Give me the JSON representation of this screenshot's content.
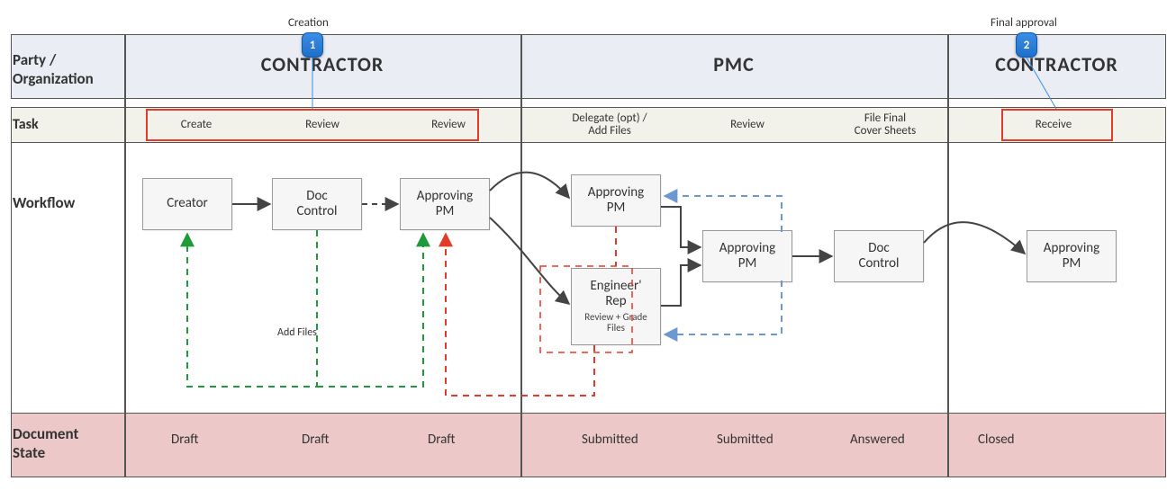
{
  "annotations": {
    "creation": "Creation",
    "final_approval": "Final approval"
  },
  "badges": {
    "one": "1",
    "two": "2"
  },
  "rows": {
    "party_label_line1": "Party /",
    "party_label_line2": "Organization",
    "task_label": "Task",
    "workflow_label": "Workflow",
    "docstate_label_line1": "Document",
    "docstate_label_line2": "State"
  },
  "parties": {
    "contractor1": "CONTRACTOR",
    "pmc": "PMC",
    "contractor2": "CONTRACTOR"
  },
  "tasks": {
    "create": "Create",
    "review1": "Review",
    "review2": "Review",
    "delegate_line1": "Delegate (opt) /",
    "delegate_line2": "Add Files",
    "review3": "Review",
    "filefinal_line1": "File Final",
    "filefinal_line2": "Cover Sheets",
    "receive": "Receive"
  },
  "workflow": {
    "creator": "Creator",
    "doc_control1": "Doc\nControl",
    "approving_pm1": "Approving\nPM",
    "approving_pm2": "Approving\nPM",
    "engineer_rep": "Engineer'\nRep",
    "engineer_rep_sub": "Review + Grade\nFiles",
    "approving_pm3": "Approving\nPM",
    "doc_control2": "Doc\nControl",
    "approving_pm4": "Approving\nPM",
    "add_files": "Add Files"
  },
  "docstates": {
    "draft1": "Draft",
    "draft2": "Draft",
    "draft3": "Draft",
    "submitted1": "Submitted",
    "submitted2": "Submitted",
    "answered": "Answered",
    "closed": "Closed"
  },
  "chart_data": {
    "type": "swimlane-workflow",
    "rows": [
      "Party / Organization",
      "Task",
      "Workflow",
      "Document State"
    ],
    "lanes": [
      {
        "party": "CONTRACTOR",
        "tasks": [
          "Create",
          "Review",
          "Review"
        ],
        "doc_states": [
          "Draft",
          "Draft",
          "Draft"
        ],
        "annotation": "Creation",
        "badge": 1,
        "highlight": "tasks"
      },
      {
        "party": "PMC",
        "tasks": [
          "Delegate (opt) / Add Files",
          "Review",
          "File Final Cover Sheets"
        ],
        "doc_states": [
          "Submitted",
          "Submitted",
          "Answered"
        ]
      },
      {
        "party": "CONTRACTOR",
        "tasks": [
          "Receive"
        ],
        "doc_states": [
          "Closed"
        ],
        "annotation": "Final approval",
        "badge": 2,
        "highlight": "tasks"
      }
    ],
    "nodes": [
      {
        "id": "creator",
        "label": "Creator",
        "lane": 0
      },
      {
        "id": "doccontrol1",
        "label": "Doc Control",
        "lane": 0
      },
      {
        "id": "apppm1",
        "label": "Approving PM",
        "lane": 0
      },
      {
        "id": "apppm2",
        "label": "Approving PM",
        "lane": 1
      },
      {
        "id": "engrep",
        "label": "Engineer' Rep",
        "sublabel": "Review + Grade Files",
        "lane": 1
      },
      {
        "id": "apppm3",
        "label": "Approving PM",
        "lane": 1
      },
      {
        "id": "doccontrol2",
        "label": "Doc Control",
        "lane": 1
      },
      {
        "id": "apppm4",
        "label": "Approving PM",
        "lane": 2
      }
    ],
    "edges": [
      {
        "from": "creator",
        "to": "doccontrol1",
        "style": "solid"
      },
      {
        "from": "doccontrol1",
        "to": "apppm1",
        "style": "dashed"
      },
      {
        "from": "apppm1",
        "to": "apppm2",
        "style": "solid-curve"
      },
      {
        "from": "apppm1",
        "to": "engrep",
        "style": "solid-curve"
      },
      {
        "from": "apppm2",
        "to": "apppm3",
        "style": "solid"
      },
      {
        "from": "engrep",
        "to": "apppm3",
        "style": "solid"
      },
      {
        "from": "apppm3",
        "to": "apppm2",
        "style": "dashed-blue",
        "meaning": "return"
      },
      {
        "from": "apppm3",
        "to": "engrep",
        "style": "dashed-blue",
        "meaning": "return"
      },
      {
        "from": "apppm3",
        "to": "doccontrol2",
        "style": "solid"
      },
      {
        "from": "doccontrol2",
        "to": "apppm4",
        "style": "solid-curve"
      },
      {
        "from": "doccontrol1",
        "to": "creator",
        "style": "dashed-green",
        "meaning": "Add Files loop"
      },
      {
        "from": "engrep",
        "to": "apppm1",
        "style": "dashed-red",
        "meaning": "return"
      },
      {
        "from": "apppm2",
        "to": "engrep",
        "style": "dashed-red"
      }
    ],
    "add_files_label": "Add Files"
  }
}
